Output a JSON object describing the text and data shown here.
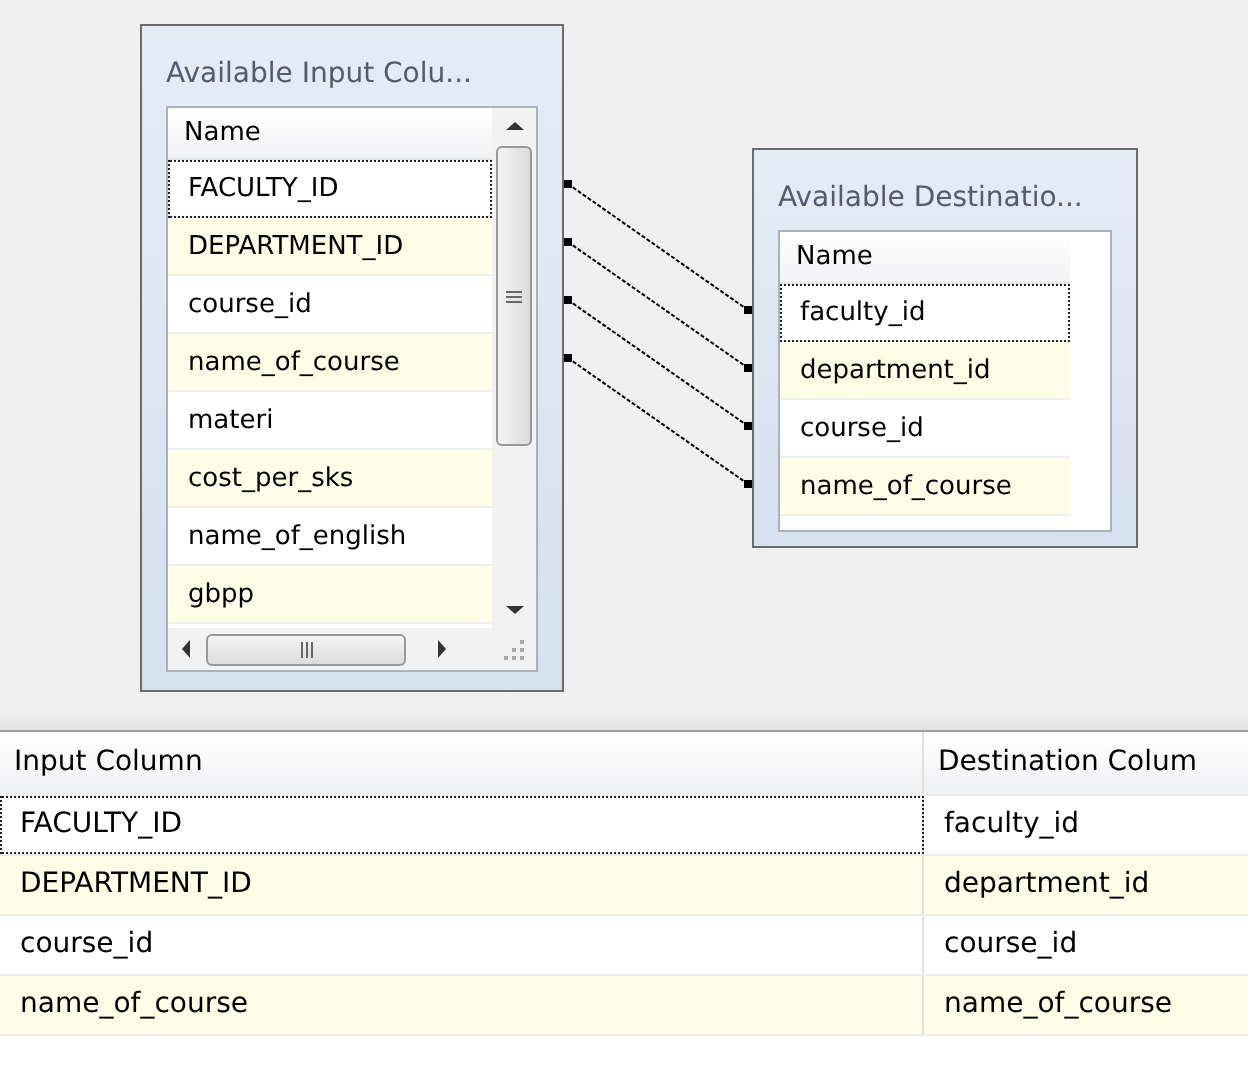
{
  "input_panel": {
    "title": "Available Input Colu...",
    "header": "Name",
    "items": [
      {
        "name": "FACULTY_ID",
        "focused": true
      },
      {
        "name": "DEPARTMENT_ID",
        "focused": false
      },
      {
        "name": "course_id",
        "focused": false
      },
      {
        "name": "name_of_course",
        "focused": false
      },
      {
        "name": "materi",
        "focused": false
      },
      {
        "name": "cost_per_sks",
        "focused": false
      },
      {
        "name": "name_of_english",
        "focused": false
      },
      {
        "name": "gbpp",
        "focused": false
      }
    ]
  },
  "destination_panel": {
    "title": "Available Destinatio...",
    "header": "Name",
    "items": [
      {
        "name": "faculty_id",
        "focused": true
      },
      {
        "name": "department_id",
        "focused": false
      },
      {
        "name": "course_id",
        "focused": false
      },
      {
        "name": "name_of_course",
        "focused": false
      }
    ]
  },
  "mapping_table": {
    "columns": [
      "Input Column",
      "Destination Colum"
    ],
    "rows": [
      {
        "input": "FACULTY_ID",
        "destination": "faculty_id",
        "focused": true
      },
      {
        "input": "DEPARTMENT_ID",
        "destination": "department_id",
        "focused": false
      },
      {
        "input": "course_id",
        "destination": "course_id",
        "focused": false
      },
      {
        "input": "name_of_course",
        "destination": "name_of_course",
        "focused": false
      }
    ]
  }
}
